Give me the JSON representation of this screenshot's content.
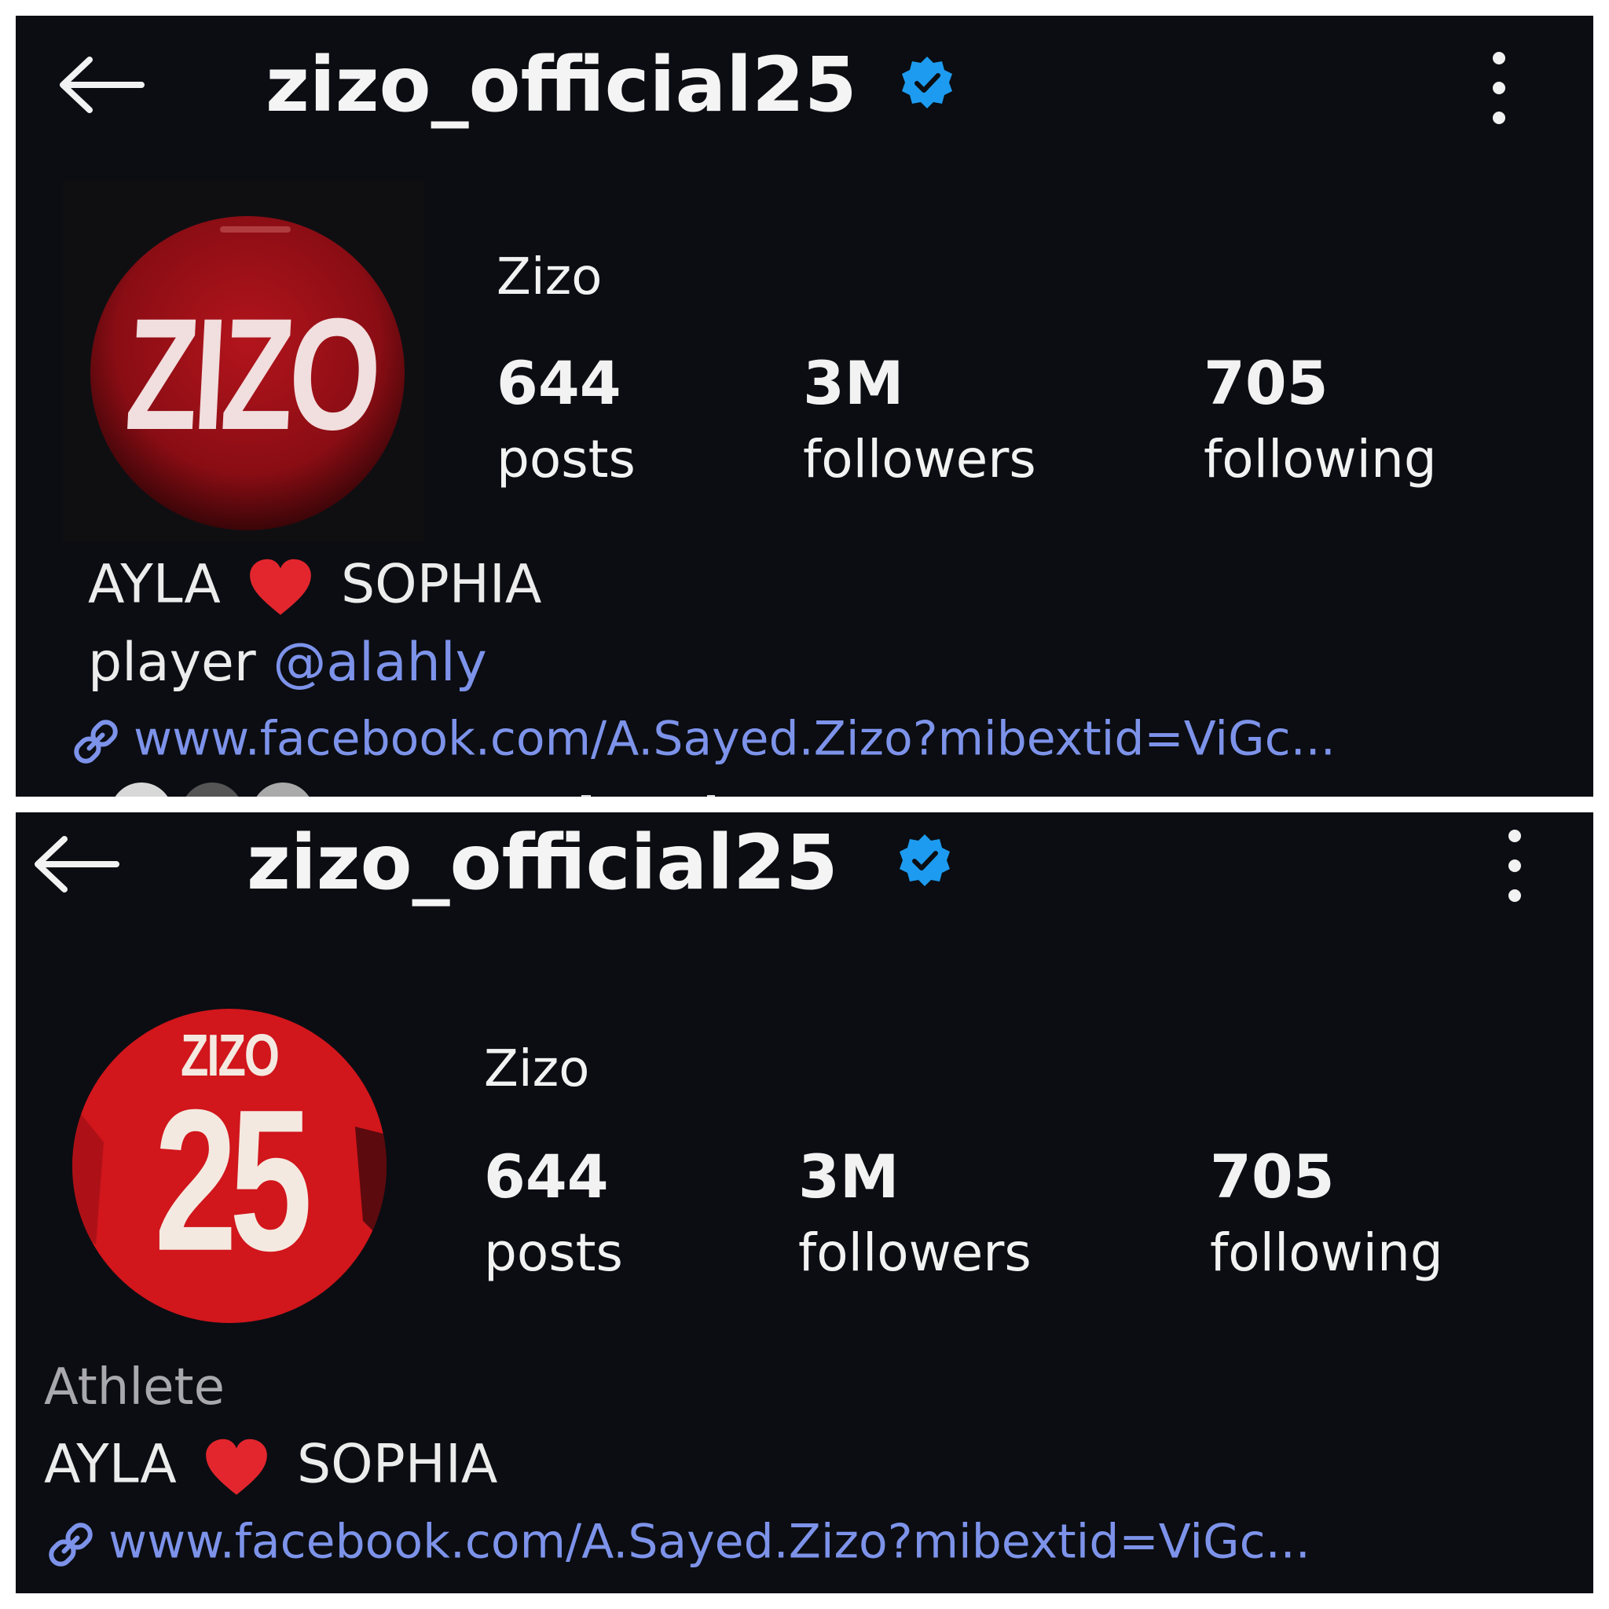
{
  "panels": [
    {
      "header": {
        "username": "zizo_official25"
      },
      "avatar": {
        "text": "ZIZO"
      },
      "profile": {
        "name": "Zizo",
        "stats": [
          {
            "value": "644",
            "label": "posts"
          },
          {
            "value": "3M",
            "label": "followers"
          },
          {
            "value": "705",
            "label": "following"
          }
        ],
        "bio_left": "AYLA",
        "bio_right": "SOPHIA",
        "bio_line2_text": "player",
        "bio_line2_mention": "@alahly",
        "link": "www.facebook.com/A.Sayed.Zizo?mibextid=ViGc..."
      }
    },
    {
      "header": {
        "username": "zizo_official25"
      },
      "avatar": {
        "top_text": "ZIZO",
        "number": "25"
      },
      "profile": {
        "name": "Zizo",
        "stats": [
          {
            "value": "644",
            "label": "posts"
          },
          {
            "value": "3M",
            "label": "followers"
          },
          {
            "value": "705",
            "label": "following"
          }
        ],
        "category": "Athlete",
        "bio_left": "AYLA",
        "bio_right": "SOPHIA",
        "link": "www.facebook.com/A.Sayed.Zizo?mibextid=ViGc..."
      }
    }
  ],
  "colors": {
    "background": "#0b0d12",
    "verified": "#1d9bf0",
    "link": "#7d93ea",
    "heart": "#e3262e",
    "avatar_red": "#b5141a"
  }
}
